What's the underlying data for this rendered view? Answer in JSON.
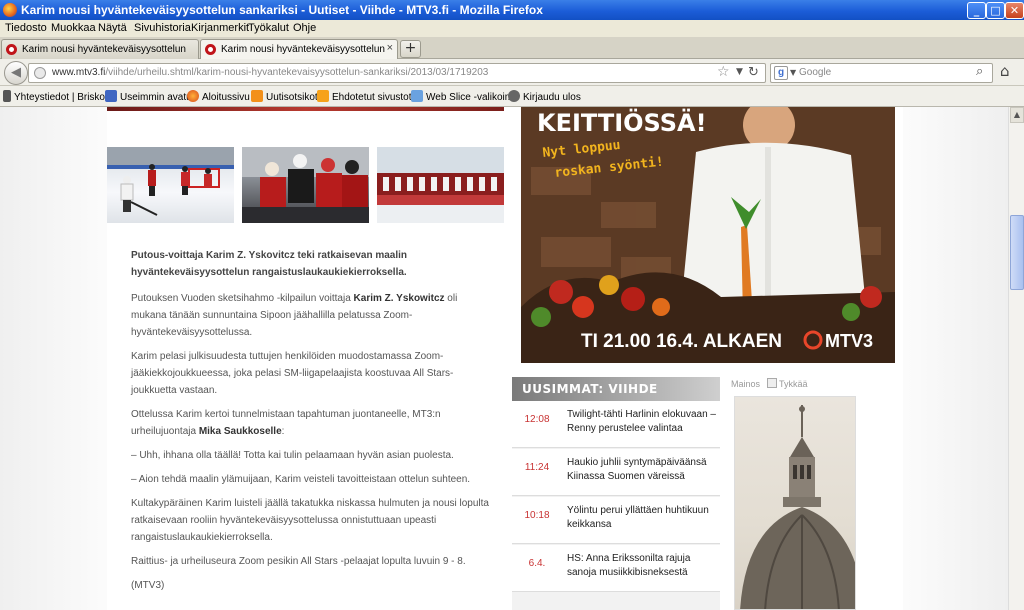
{
  "window": {
    "title": "Karim nousi hyväntekeväisyysottelun sankariksi - Uutiset - Viihde - MTV3.fi - Mozilla Firefox",
    "min_glyph": "_",
    "max_glyph": "□",
    "close_glyph": "✕"
  },
  "menu": [
    "Tiedosto",
    "Muokkaa",
    "Näytä",
    "Sivuhistoria",
    "Kirjanmerkit",
    "Työkalut",
    "Ohje"
  ],
  "tabs": [
    {
      "label": "Karim nousi hyväntekeväisyysottelun sankari...",
      "active": false
    },
    {
      "label": "Karim nousi hyväntekeväisyysottelun sankari...",
      "active": true
    }
  ],
  "tab_close_glyph": "×",
  "new_tab_glyph": "+",
  "nav": {
    "url_host": "www.mtv3.fi",
    "url_path": "/viihde/urheilu.shtml/karim-nousi-hyvantekevaisyysottelun-sankariksi/2013/03/1719203",
    "search_placeholder": "Google",
    "search_engine_letter": "g"
  },
  "bookmarks": [
    {
      "label": "Yhteystiedot | Brisko",
      "icon": "pin-icon"
    },
    {
      "label": "Useimmin avatut",
      "icon": "folder-icon"
    },
    {
      "label": "Aloitussivu",
      "icon": "firefox-icon"
    },
    {
      "label": "Uutisotsikot",
      "icon": "rss-icon"
    },
    {
      "label": "Ehdotetut sivustot",
      "icon": "bulb-icon"
    },
    {
      "label": "Web Slice -valikoima",
      "icon": "webslice-icon"
    },
    {
      "label": "Kirjaudu ulos",
      "icon": "gear-icon"
    }
  ],
  "article": {
    "lead": "Putous-voittaja Karim Z. Yskovitcz teki ratkaisevan maalin hyväntekeväisyysottelun rangaistuslaukaukiekierroksella.",
    "p1_a": "Putouksen Vuoden sketsihahmo -kilpailun voittaja ",
    "p1_b": "Karim Z. Yskowitcz",
    "p1_c": " oli mukana tänään sunnuntaina Sipoon jäähallilla pelatussa Zoom-hyväntekeväisyysottelussa.",
    "p2": "Karim pelasi julkisuudesta tuttujen henkilöiden muodostamassa Zoom-jääkiekkojoukkueessa, joka pelasi SM-liigapelaajista koostuvaa All Stars-joukkuetta vastaan.",
    "p3_a": "Ottelussa Karim kertoi tunnelmistaan tapahtuman juontaneelle, MT3:n urheilujuontaja ",
    "p3_b": "Mika Saukkoselle",
    "p3_c": ":",
    "p4": "– Uhh, ihhana olla täällä! Totta kai tulin pelaamaan hyvän asian puolesta.",
    "p5": "– Aion tehdä maalin ylämuijaan, Karim veisteli tavoitteistaan ottelun suhteen.",
    "p6": "Kultakypäräinen Karim luisteli jäällä takatukka niskassa hulmuten ja nousi lopulta ratkaisevaan rooliin hyväntekeväisyysottelussa onnistuttuaan upeasti rangaistuslaukaukiekierroksella.",
    "p7": "Raittius- ja urheiluseura Zoom pesikin All Stars -pelaajat lopulta luvuin 9 - 8.",
    "p8": "(MTV3)"
  },
  "ad": {
    "headline": "KEITTIÖSSÄ!",
    "subline1": "Nyt loppuu",
    "subline2": "roskan syönti!",
    "schedule": "TI 21.00 16.4. ALKAEN",
    "brand": "MTV3"
  },
  "uusimmat": {
    "header": "UUSIMMAT: VIIHDE",
    "items": [
      {
        "time": "12:08",
        "title": "Twilight-tähti Harlinin elokuvaan – Renny perustelee valintaa"
      },
      {
        "time": "11:24",
        "title": "Haukio juhlii syntymäpäiväänsä Kiinassa Suomen väreissä"
      },
      {
        "time": "10:18",
        "title": "Yölintu perui yllättäen huhtikuun keikkansa"
      },
      {
        "time": "6.4.",
        "title": "HS: Anna Erikssonilta rajuja sanoja musiikkibisneksestä"
      }
    ]
  },
  "mainos": {
    "label": "Mainos",
    "like_label": "Tykkää"
  },
  "colors": {
    "accent_red": "#c83232",
    "titlebar_blue": "#1c5dd8",
    "header_gray": "#7a7a7a"
  }
}
